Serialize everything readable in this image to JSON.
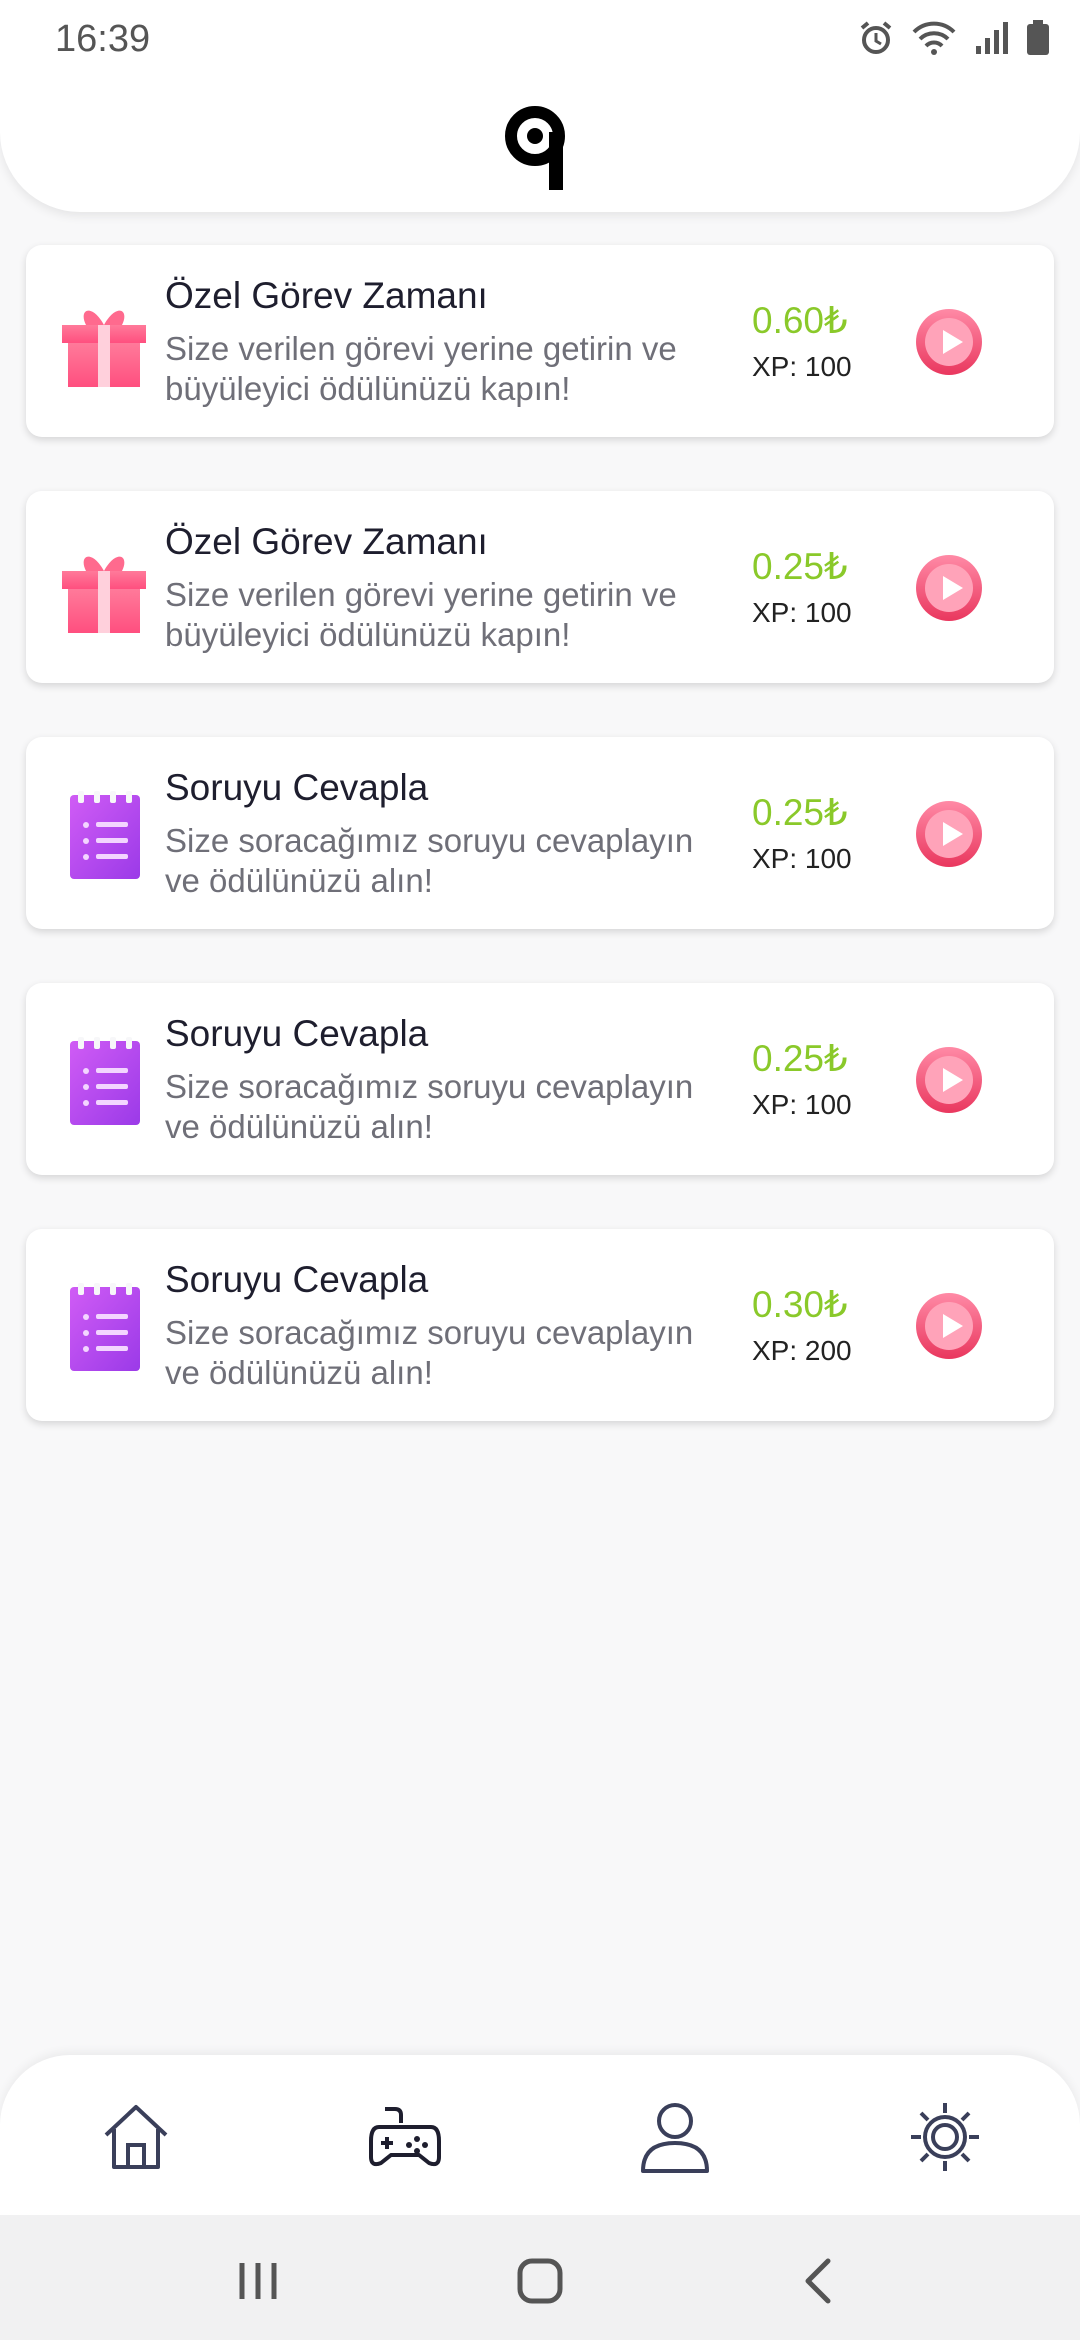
{
  "status_bar": {
    "time": "16:39",
    "icons": [
      "alarm-icon",
      "wifi-icon",
      "signal-icon",
      "battery-icon"
    ]
  },
  "header": {
    "logo": "app-logo"
  },
  "tasks": [
    {
      "icon": "gift-icon",
      "title": "Özel Görev Zamanı",
      "description": "Size verilen görevi yerine getirin ve büyüleyici ödülünüzü kapın!",
      "price": "0.60₺",
      "xp": "XP: 100"
    },
    {
      "icon": "gift-icon",
      "title": "Özel Görev Zamanı",
      "description": "Size verilen görevi yerine getirin ve büyüleyici ödülünüzü kapın!",
      "price": "0.25₺",
      "xp": "XP: 100"
    },
    {
      "icon": "notepad-icon",
      "title": "Soruyu Cevapla",
      "description": "Size soracağımız soruyu cevaplayın ve ödülünüzü alın!",
      "price": "0.25₺",
      "xp": "XP: 100"
    },
    {
      "icon": "notepad-icon",
      "title": "Soruyu Cevapla",
      "description": "Size soracağımız soruyu cevaplayın ve ödülünüzü alın!",
      "price": "0.25₺",
      "xp": "XP: 100"
    },
    {
      "icon": "notepad-icon",
      "title": "Soruyu Cevapla",
      "description": "Size soracağımız soruyu cevaplayın ve ödülünüzü alın!",
      "price": "0.30₺",
      "xp": "XP: 200"
    }
  ],
  "bottom_nav": [
    "home-icon",
    "gamepad-icon",
    "profile-icon",
    "settings-icon"
  ],
  "system_nav": [
    "recents-icon",
    "home-button-icon",
    "back-icon"
  ],
  "colors": {
    "price": "#8ac92a",
    "play": "#f0567a",
    "gift": "#ff5c8a",
    "notepad": "#b14cf0"
  }
}
